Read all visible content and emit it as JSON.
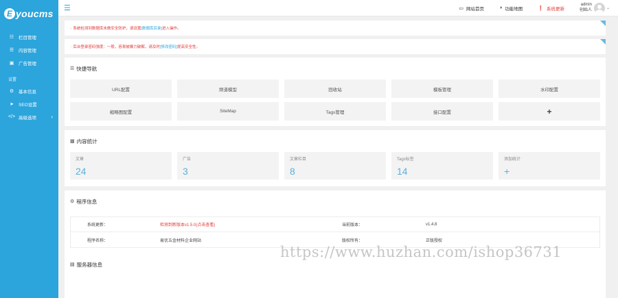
{
  "brand": {
    "logo_letter": "E",
    "logo_text": "youcms"
  },
  "sidebar": {
    "items": [
      {
        "label": "栏目管理",
        "icon": "sitemap-icon"
      },
      {
        "label": "内容管理",
        "icon": "list-icon"
      },
      {
        "label": "广告管理",
        "icon": "image-icon"
      }
    ],
    "section_title": "设置",
    "settings": [
      {
        "label": "基本信息",
        "icon": "gear-icon"
      },
      {
        "label": "SEO设置",
        "icon": "paper-plane-icon"
      },
      {
        "label": "高级选项",
        "icon": "code-icon"
      }
    ]
  },
  "topbar": {
    "home_label": "网站首页",
    "map_label": "功能地图",
    "update_label": "系统更新",
    "user_name": "admin",
    "user_role": "创始人"
  },
  "notices": [
    {
      "prefix": "· 系统检测到数据库未做安全防护，请设置",
      "link": "[数据库目录]",
      "suffix": "进入操作。"
    },
    {
      "prefix": "· 后台登录密码强度：一般，容易被暴力破解，请及时",
      "link": "[修改密码]",
      "suffix": "提高安全性。"
    }
  ],
  "quicknav": {
    "title": "快捷导航",
    "items": [
      "URL配置",
      "频道模型",
      "回收站",
      "模板管理",
      "水印配置",
      "缩略图配置",
      "SiteMap",
      "Tags管理",
      "接口配置",
      "+"
    ]
  },
  "stats": {
    "title": "内容统计",
    "items": [
      {
        "label": "文章",
        "value": "24"
      },
      {
        "label": "广告",
        "value": "3"
      },
      {
        "label": "文章栏目",
        "value": "8"
      },
      {
        "label": "Tags标签",
        "value": "14"
      },
      {
        "label": "添加统计",
        "value": "+"
      }
    ]
  },
  "program": {
    "title": "程序信息",
    "rows": [
      {
        "k1": "系统更新：",
        "v1": "检测到新版本v1.5.0(点击查看)",
        "k2": "当前版本：",
        "v2": "v1.4.8"
      },
      {
        "k1": "程序名称：",
        "v1": "易优五金材料企业网站",
        "k2": "版权所有：",
        "v2": "正版授权"
      }
    ]
  },
  "server": {
    "title": "服务器信息"
  },
  "watermark": "https://www.huzhan.com/ishop36731",
  "colors": {
    "accent": "#2ca4dc",
    "alert": "#e23a3a"
  }
}
